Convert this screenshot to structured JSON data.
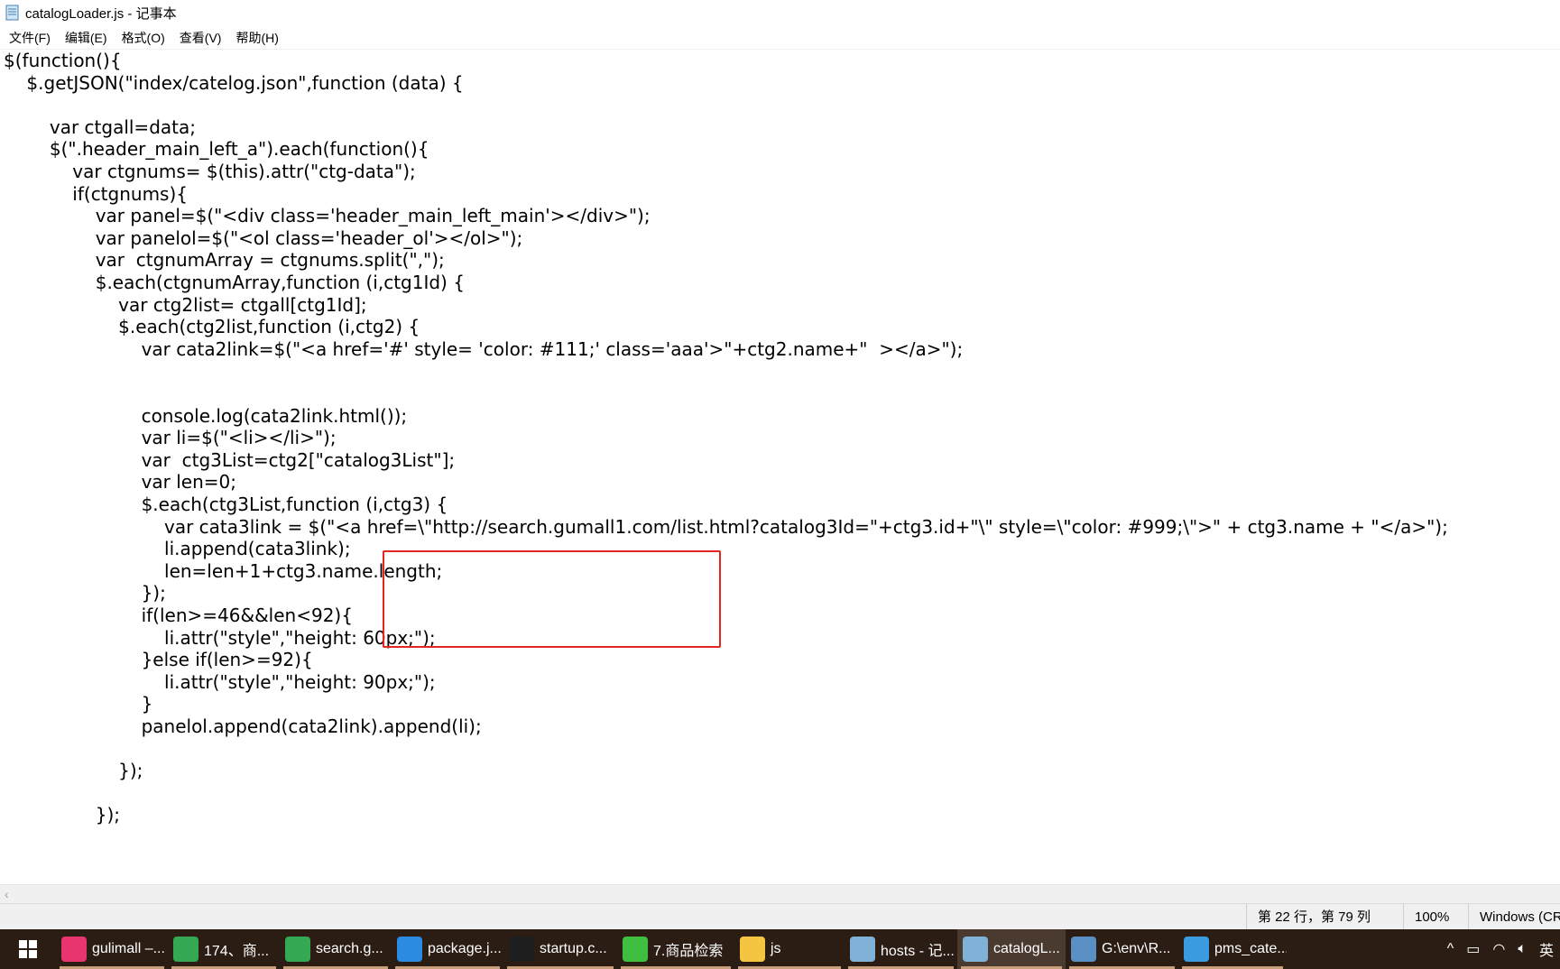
{
  "window": {
    "title": "catalogLoader.js - 记事本"
  },
  "menu": {
    "items": [
      "文件(F)",
      "编辑(E)",
      "格式(O)",
      "查看(V)",
      "帮助(H)"
    ]
  },
  "editor": {
    "lines": [
      "$(function(){",
      "    $.getJSON(\"index/catelog.json\",function (data) {",
      "",
      "        var ctgall=data;",
      "        $(\".header_main_left_a\").each(function(){",
      "            var ctgnums= $(this).attr(\"ctg-data\");",
      "            if(ctgnums){",
      "                var panel=$(\"<div class='header_main_left_main'></div>\");",
      "                var panelol=$(\"<ol class='header_ol'></ol>\");",
      "                var  ctgnumArray = ctgnums.split(\",\");",
      "                $.each(ctgnumArray,function (i,ctg1Id) {",
      "                    var ctg2list= ctgall[ctg1Id];",
      "                    $.each(ctg2list,function (i,ctg2) {",
      "                        var cata2link=$(\"<a href='#' style= 'color: #111;' class='aaa'>\"+ctg2.name+\"  ></a>\");",
      "",
      "",
      "                        console.log(cata2link.html());",
      "                        var li=$(\"<li></li>\");",
      "                        var  ctg3List=ctg2[\"catalog3List\"];",
      "                        var len=0;",
      "                        $.each(ctg3List,function (i,ctg3) {",
      "                            var cata3link = $(\"<a href=\\\"http://search.gumall1.com/list.html?catalog3Id=\"+ctg3.id+\"\\\" style=\\\"color: #999;\\\">\" + ctg3.name + \"</a>\");",
      "                            li.append(cata3link);",
      "                            len=len+1+ctg3.name.length;",
      "                        });",
      "                        if(len>=46&&len<92){",
      "                            li.attr(\"style\",\"height: 60px;\");",
      "                        }else if(len>=92){",
      "                            li.attr(\"style\",\"height: 90px;\");",
      "                        }",
      "                        panelol.append(cata2link).append(li);",
      "",
      "                    });",
      "",
      "                });"
    ]
  },
  "statusbar": {
    "position": "第 22 行，第 79 列",
    "zoom": "100%",
    "line_ending": "Windows (CRLF)"
  },
  "taskbar": {
    "items": [
      {
        "label": "gulimall –...",
        "icon": "intellij-icon",
        "color": "#e8356d",
        "active": false
      },
      {
        "label": "174、商...",
        "icon": "chrome-icon",
        "color": "#34a853",
        "active": false
      },
      {
        "label": "search.g...",
        "icon": "chrome-icon",
        "color": "#34a853",
        "active": false
      },
      {
        "label": "package.j...",
        "icon": "vscode-icon",
        "color": "#2a8be0",
        "active": false
      },
      {
        "label": "startup.c...",
        "icon": "terminal-icon",
        "color": "#1e1e1e",
        "active": false
      },
      {
        "label": "7.商品检索",
        "icon": "evernote-icon",
        "color": "#3fbf3f",
        "active": false
      },
      {
        "label": "js",
        "icon": "folder-icon",
        "color": "#f5c542",
        "active": false
      },
      {
        "label": "hosts - 记...",
        "icon": "notepad-icon",
        "color": "#7fb2d6",
        "active": false
      },
      {
        "label": "catalogL...",
        "icon": "notepad-icon",
        "color": "#7fb2d6",
        "active": true
      },
      {
        "label": "G:\\env\\R...",
        "icon": "explorer-window-icon",
        "color": "#5a8fc4",
        "active": false
      },
      {
        "label": "pms_cate...",
        "icon": "navicat-icon",
        "color": "#3b9be0",
        "active": false
      }
    ],
    "tray": {
      "chevron": "^",
      "ime": "英"
    }
  }
}
